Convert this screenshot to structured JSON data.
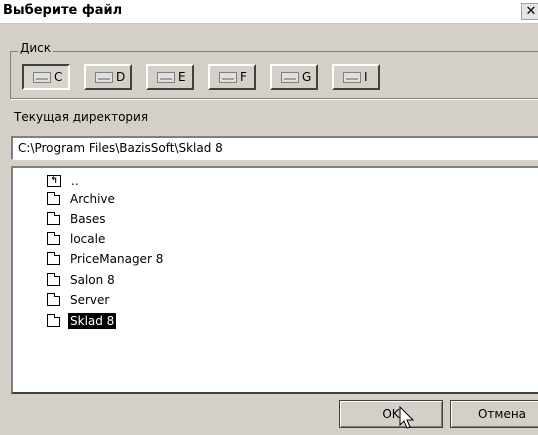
{
  "window": {
    "title": "Выберите файл",
    "close_glyph": "✕"
  },
  "drives": {
    "legend": "Диск",
    "items": [
      {
        "label": "C",
        "selected": true
      },
      {
        "label": "D",
        "selected": false
      },
      {
        "label": "E",
        "selected": false
      },
      {
        "label": "F",
        "selected": false
      },
      {
        "label": "G",
        "selected": false
      },
      {
        "label": "I",
        "selected": false
      }
    ]
  },
  "current_dir": {
    "label": "Текущая директория",
    "path": "C:\\Program Files\\BazisSoft\\Sklad 8"
  },
  "folders": {
    "items": [
      {
        "label": "..",
        "icon": "up-folder-icon"
      },
      {
        "label": "Archive",
        "icon": "folder-icon"
      },
      {
        "label": "Bases",
        "icon": "folder-icon"
      },
      {
        "label": "locale",
        "icon": "folder-icon"
      },
      {
        "label": "PriceManager 8",
        "icon": "folder-icon"
      },
      {
        "label": "Salon 8",
        "icon": "folder-icon"
      },
      {
        "label": "Server",
        "icon": "folder-icon"
      },
      {
        "label": "Sklad 8",
        "icon": "folder-icon",
        "selected": true
      }
    ]
  },
  "buttons": {
    "ok_label": "OK",
    "cancel_label": "Отмена"
  },
  "colors": {
    "selection": "#000000",
    "dialog_bg": "#d4d0c8"
  }
}
